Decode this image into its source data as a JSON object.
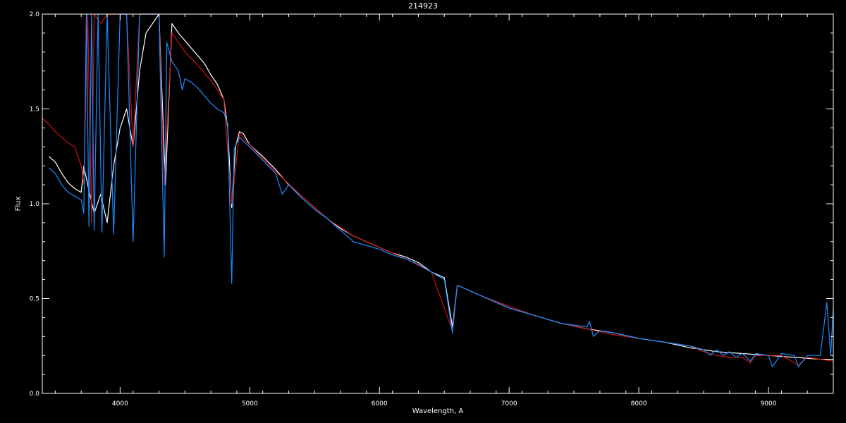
{
  "chart_data": {
    "type": "line",
    "title": "214923",
    "xlabel": "Wavelength, A",
    "ylabel": "Flux",
    "xlim": [
      3400,
      9500
    ],
    "ylim": [
      0.0,
      2.0
    ],
    "xticks": [
      4000,
      5000,
      6000,
      7000,
      8000,
      9000
    ],
    "xtick_labels": [
      "4000",
      "5000",
      "6000",
      "7000",
      "8000",
      "9000"
    ],
    "yticks": [
      0.0,
      0.5,
      1.0,
      1.5,
      2.0
    ],
    "ytick_labels": [
      "0.0",
      "0.5",
      "1.0",
      "1.5",
      "2.0"
    ],
    "grid": false,
    "colors": {
      "background": "#000000",
      "axes": "#ffffff",
      "observed": "#ffffff",
      "model": "#cc1111",
      "corrected": "#1a8cff"
    },
    "series": [
      {
        "color": "#ffffff",
        "x": [
          3450,
          3500,
          3550,
          3600,
          3650,
          3700,
          3720,
          3750,
          3800,
          3850,
          3900,
          3950,
          4000,
          4050,
          4100,
          4150,
          4200,
          4250,
          4300,
          4350,
          4400,
          4450,
          4500,
          4550,
          4600,
          4650,
          4700,
          4750,
          4800,
          4830,
          4861,
          4890,
          4920,
          4950,
          5000,
          5100,
          5200,
          5300,
          5400,
          5500,
          5600,
          5700,
          5800,
          5900,
          6000,
          6100,
          6200,
          6300,
          6400,
          6500,
          6563,
          6600,
          6700,
          6800,
          6900,
          7000,
          7200,
          7400,
          7600,
          7800,
          8000,
          8200,
          8400,
          8600,
          8800,
          9000,
          9200,
          9400,
          9500
        ],
        "y": [
          1.25,
          1.22,
          1.16,
          1.11,
          1.08,
          1.06,
          1.2,
          1.1,
          0.95,
          1.05,
          0.9,
          1.2,
          1.4,
          1.5,
          1.3,
          1.7,
          1.9,
          1.95,
          2.0,
          1.1,
          1.95,
          1.9,
          1.86,
          1.82,
          1.78,
          1.74,
          1.68,
          1.63,
          1.55,
          1.4,
          0.98,
          1.3,
          1.38,
          1.37,
          1.31,
          1.25,
          1.18,
          1.1,
          1.04,
          0.98,
          0.92,
          0.87,
          0.83,
          0.8,
          0.77,
          0.74,
          0.72,
          0.69,
          0.64,
          0.61,
          0.35,
          0.57,
          0.54,
          0.51,
          0.48,
          0.45,
          0.41,
          0.37,
          0.34,
          0.32,
          0.29,
          0.27,
          0.24,
          0.22,
          0.21,
          0.2,
          0.19,
          0.18,
          0.18
        ]
      },
      {
        "color": "#cc1111",
        "x": [
          3400,
          3450,
          3500,
          3550,
          3600,
          3650,
          3700,
          3720,
          3750,
          3780,
          3800,
          3850,
          3900,
          3950,
          4000,
          4050,
          4100,
          4150,
          4200,
          4250,
          4300,
          4340,
          4400,
          4450,
          4500,
          4600,
          4700,
          4800,
          4861,
          4920,
          5000,
          5200,
          5400,
          5600,
          5800,
          6000,
          6200,
          6400,
          6563,
          6600,
          6800,
          7000,
          7200,
          7400,
          7600,
          7800,
          8000,
          8200,
          8400,
          8500,
          8600,
          8700,
          8800,
          8860,
          8900,
          9000,
          9100,
          9230,
          9300,
          9400,
          9500
        ],
        "y": [
          1.45,
          1.42,
          1.38,
          1.35,
          1.32,
          1.3,
          1.2,
          1.1,
          2.0,
          0.9,
          2.0,
          1.95,
          2.0,
          2.0,
          2.0,
          2.0,
          1.3,
          2.0,
          2.0,
          2.0,
          2.0,
          1.1,
          1.9,
          1.85,
          1.8,
          1.73,
          1.65,
          1.55,
          1.0,
          1.37,
          1.31,
          1.17,
          1.04,
          0.92,
          0.83,
          0.77,
          0.71,
          0.64,
          0.33,
          0.57,
          0.51,
          0.46,
          0.41,
          0.37,
          0.34,
          0.31,
          0.29,
          0.27,
          0.25,
          0.22,
          0.2,
          0.19,
          0.19,
          0.16,
          0.2,
          0.2,
          0.2,
          0.15,
          0.19,
          0.18,
          0.17
        ]
      },
      {
        "color": "#1a8cff",
        "x": [
          3450,
          3500,
          3550,
          3600,
          3650,
          3700,
          3720,
          3740,
          3760,
          3780,
          3800,
          3830,
          3860,
          3900,
          3950,
          4000,
          4050,
          4100,
          4150,
          4200,
          4250,
          4300,
          4340,
          4360,
          4400,
          4450,
          4480,
          4500,
          4550,
          4600,
          4650,
          4700,
          4750,
          4800,
          4830,
          4861,
          4880,
          4920,
          5000,
          5100,
          5200,
          5250,
          5300,
          5400,
          5500,
          5600,
          5700,
          5800,
          5900,
          6000,
          6100,
          6200,
          6300,
          6400,
          6500,
          6563,
          6600,
          6800,
          7000,
          7200,
          7400,
          7600,
          7620,
          7650,
          7700,
          7800,
          8000,
          8200,
          8400,
          8500,
          8550,
          8600,
          8650,
          8700,
          8750,
          8800,
          8860,
          8900,
          9000,
          9030,
          9100,
          9200,
          9230,
          9300,
          9400,
          9450,
          9480,
          9500
        ],
        "y": [
          1.19,
          1.16,
          1.1,
          1.06,
          1.04,
          1.02,
          0.95,
          2.0,
          0.88,
          2.0,
          0.86,
          2.0,
          0.85,
          2.0,
          0.84,
          2.0,
          2.0,
          0.8,
          2.0,
          2.0,
          2.0,
          2.0,
          0.72,
          1.85,
          1.75,
          1.7,
          1.6,
          1.66,
          1.64,
          1.61,
          1.57,
          1.53,
          1.5,
          1.48,
          1.42,
          0.58,
          1.29,
          1.35,
          1.3,
          1.23,
          1.16,
          1.05,
          1.1,
          1.03,
          0.97,
          0.92,
          0.86,
          0.8,
          0.78,
          0.76,
          0.73,
          0.71,
          0.68,
          0.64,
          0.6,
          0.32,
          0.57,
          0.51,
          0.45,
          0.41,
          0.37,
          0.35,
          0.38,
          0.3,
          0.33,
          0.32,
          0.29,
          0.27,
          0.25,
          0.23,
          0.2,
          0.23,
          0.2,
          0.22,
          0.19,
          0.21,
          0.17,
          0.21,
          0.2,
          0.14,
          0.21,
          0.2,
          0.14,
          0.2,
          0.2,
          0.48,
          0.2,
          0.45
        ]
      }
    ]
  }
}
